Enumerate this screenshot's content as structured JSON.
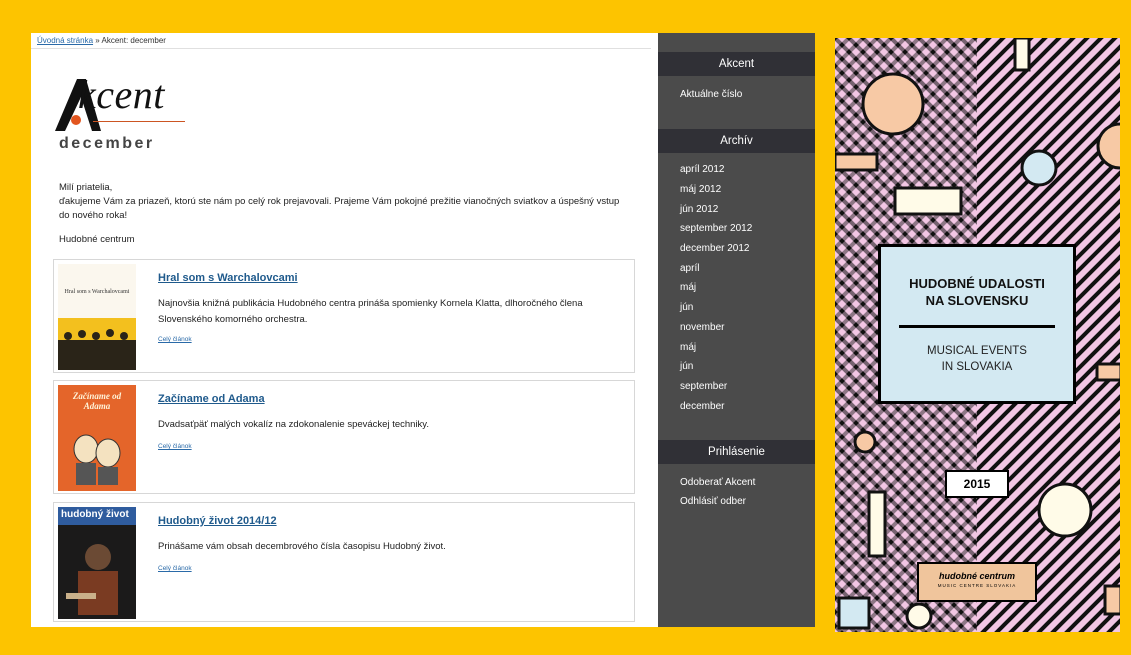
{
  "breadcrumb": {
    "home": "Úvodná stránka",
    "separator": " » ",
    "current": "Akcent: december"
  },
  "logo": {
    "text": "kcent",
    "icon": "akcent-logo-icon"
  },
  "issue": {
    "title": "december"
  },
  "intro": {
    "greeting": "Milí priatelia,",
    "body": "ďakujeme Vám za priazeň, ktorú ste nám po celý rok prejavovali. Prajeme Vám pokojné prežitie vianočných sviatkov a úspešný vstup do nového roka!",
    "signature": "Hudobné centrum"
  },
  "articles": [
    {
      "title": "Hral som s Warchalovcami",
      "description": "Najnovšia knižná publikácia Hudobného centra prináša spomienky Kornela Klatta, dlhoročného člena Slovenského komorného orchestra.",
      "more": "Celý článok",
      "thumb_text": "Hral som s Warchalovcami"
    },
    {
      "title": "Začíname od Adama",
      "description": "Dvadsaťpäť malých vokalíz na zdokonalenie speváckej techniky.",
      "more": "Celý článok",
      "thumb_text": "Začíname od Adama"
    },
    {
      "title": "Hudobný život 2014/12",
      "description": "Prinášame vám obsah decembrového čísla časopisu Hudobný život.",
      "more": "Celý článok",
      "thumb_text": "hudobný život"
    }
  ],
  "sidebar": {
    "akcent_heading": "Akcent",
    "akcent_items": [
      "Aktuálne číslo"
    ],
    "archive_heading": "Archív",
    "archive_items": [
      "apríl 2012",
      "máj 2012",
      "jún 2012",
      "september 2012",
      "december 2012",
      "apríl",
      "máj",
      "jún",
      "november",
      "máj",
      "jún",
      "september",
      "december"
    ],
    "login_heading": "Prihlásenie",
    "login_items": [
      "Odoberať Akcent",
      "Odhlásiť odber"
    ]
  },
  "poster": {
    "title_line1": "HUDOBNÉ UDALOSTI",
    "title_line2": "NA SLOVENSKU",
    "subtitle_line1": "MUSICAL EVENTS",
    "subtitle_line2": "IN SLOVAKIA",
    "year": "2015",
    "logo_main": "hudobné centrum",
    "logo_sub": "MUSIC CENTRE SLOVAKIA"
  },
  "colors": {
    "frame": "#fdc400",
    "sidebar": "#4b4b4b",
    "sidebar_heading": "#303036",
    "link": "#1f5a8c",
    "poster_bg": "#f2c6e4",
    "poster_box": "#d3e9f2"
  }
}
